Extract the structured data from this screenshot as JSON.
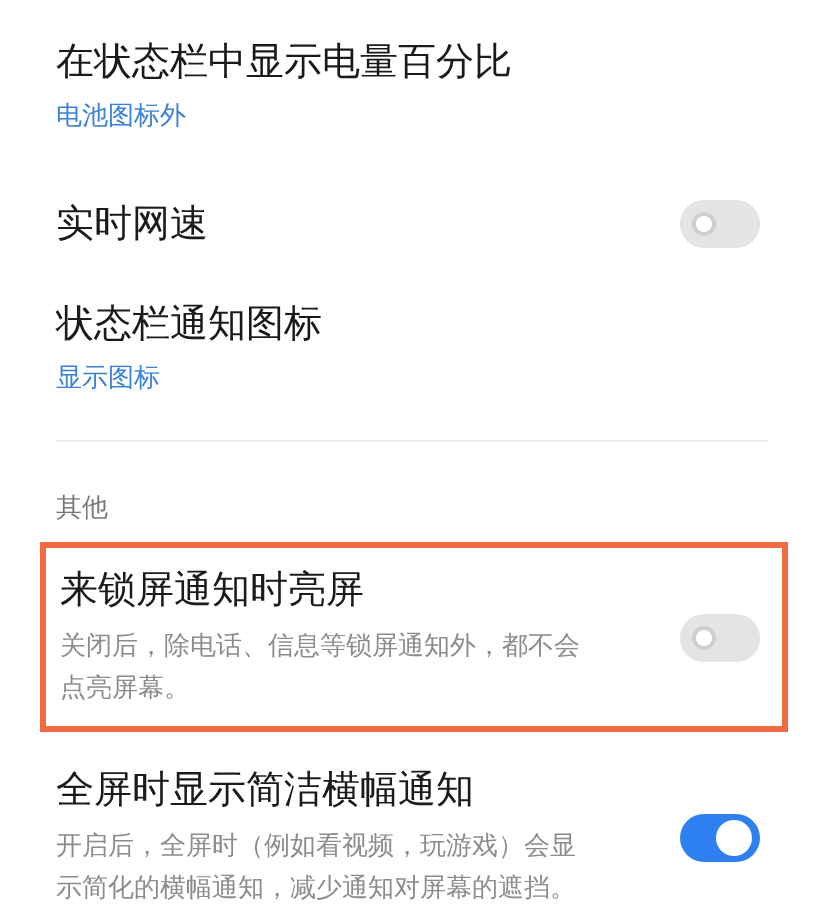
{
  "groups": [
    {
      "items": [
        {
          "kind": "value",
          "title": "在状态栏中显示电量百分比",
          "value": "电池图标外"
        },
        {
          "kind": "toggle",
          "title": "实时网速",
          "on": false,
          "highlighted": false
        },
        {
          "kind": "value",
          "title": "状态栏通知图标",
          "value": "显示图标"
        }
      ]
    },
    {
      "header": "其他",
      "items": [
        {
          "kind": "toggle",
          "title": "来锁屏通知时亮屏",
          "description": "关闭后，除电话、信息等锁屏通知外，都不会点亮屏幕。",
          "on": false,
          "highlighted": true
        },
        {
          "kind": "toggle",
          "title": "全屏时显示简洁横幅通知",
          "description": "开启后，全屏时（例如看视频，玩游戏）会显示简化的横幅通知，减少通知对屏幕的遮挡。",
          "on": true,
          "highlighted": false
        }
      ]
    }
  ]
}
